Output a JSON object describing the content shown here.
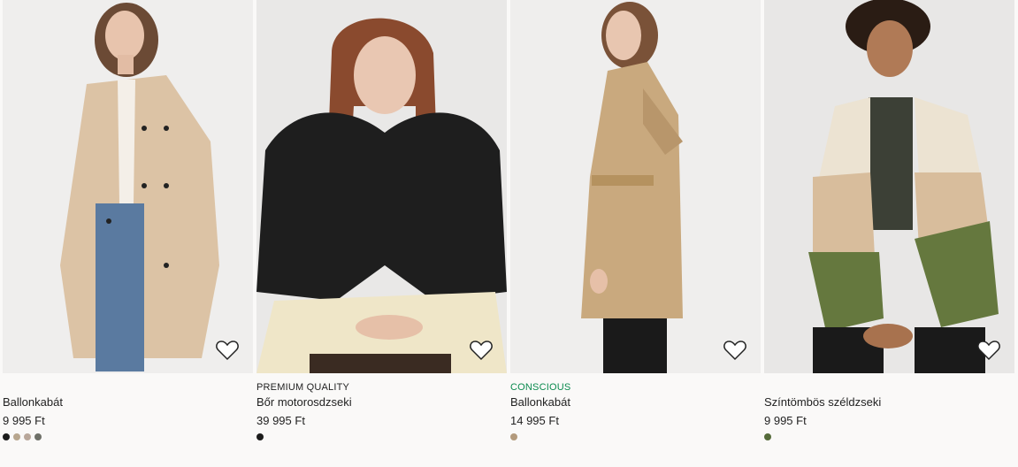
{
  "products": [
    {
      "badge": "",
      "name": "Ballonkabát",
      "price": "9 995 Ft",
      "swatches": [
        "#1c1c1c",
        "#b8a68e",
        "#b9a79a",
        "#6e7068"
      ]
    },
    {
      "badge": "PREMIUM QUALITY",
      "name": "Bőr motorosdzseki",
      "price": "39 995 Ft",
      "swatches": [
        "#1c1c1c"
      ]
    },
    {
      "badge": "CONSCIOUS",
      "name": "Ballonkabát",
      "price": "14 995 Ft",
      "swatches": [
        "#b39a7c"
      ]
    },
    {
      "badge": "",
      "name": "Színtömbös széldzseki",
      "price": "9 995 Ft",
      "swatches": [
        "#556b3a"
      ]
    }
  ],
  "colors": {
    "conscious_green": "#0a8a4e"
  },
  "icons": {
    "favorite": "heart-outline-icon"
  }
}
